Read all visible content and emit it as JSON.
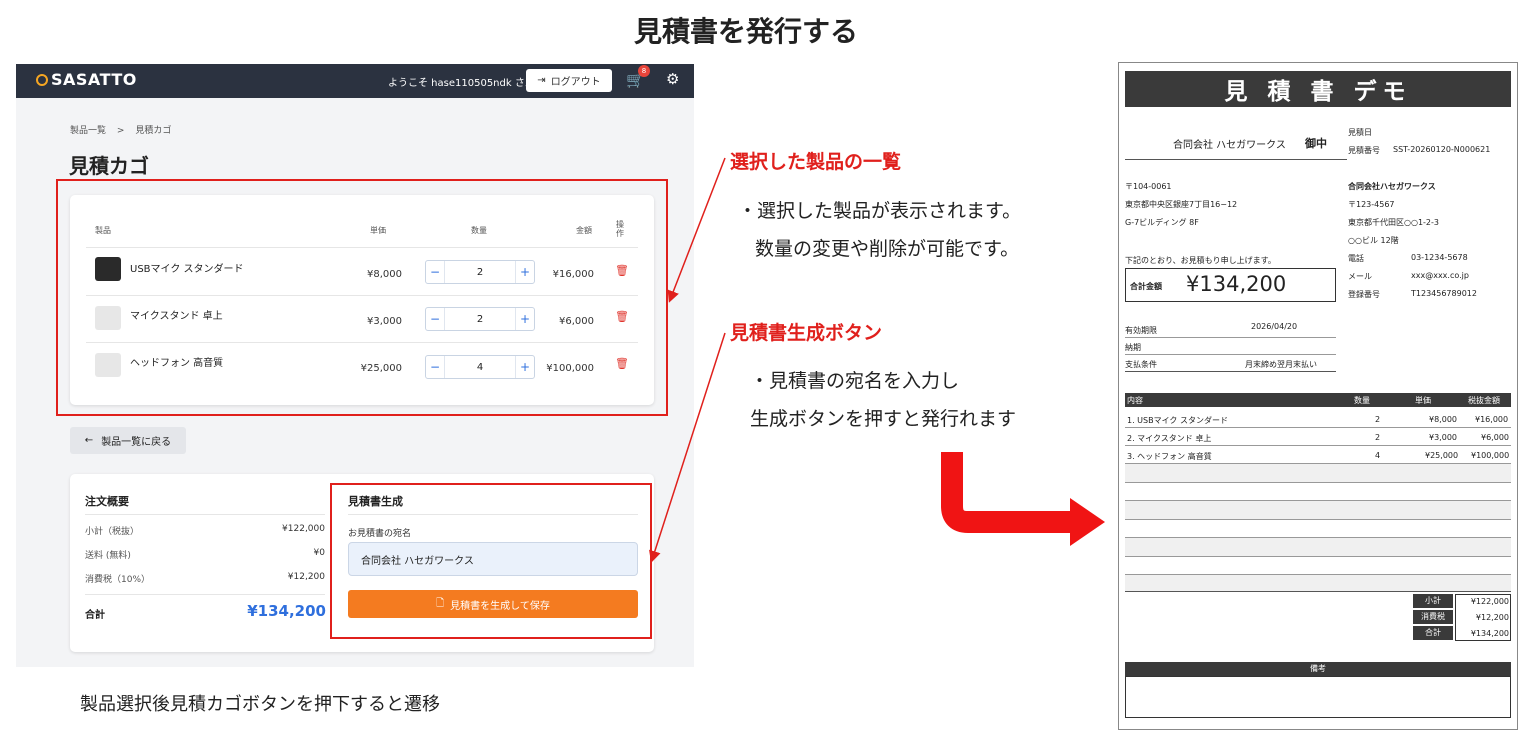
{
  "main_title": "見積書を発行する",
  "appbar": {
    "logo": "SASATTO",
    "welcome": "ようこそ hase110505ndk さん",
    "logout_label": "ログアウト",
    "cart_count": "8"
  },
  "breadcrumb": {
    "root": "製品一覧",
    "sep": ">",
    "current": "見積カゴ"
  },
  "page_title": "見積カゴ",
  "cart_table": {
    "headers": {
      "product": "製品",
      "unit_price": "単価",
      "quantity": "数量",
      "amount": "金額",
      "action": "操作"
    },
    "rows": [
      {
        "name": "USBマイク スタンダード",
        "unit_price": "¥8,000",
        "quantity": "2",
        "amount": "¥16,000"
      },
      {
        "name": "マイクスタンド 卓上",
        "unit_price": "¥3,000",
        "quantity": "2",
        "amount": "¥6,000"
      },
      {
        "name": "ヘッドフォン 高音質",
        "unit_price": "¥25,000",
        "quantity": "4",
        "amount": "¥100,000"
      }
    ]
  },
  "back_button": "製品一覧に戻る",
  "order_summary": {
    "title": "注文概要",
    "subtotal_label": "小計（税抜）",
    "subtotal": "¥122,000",
    "shipping_label": "送料 (無料)",
    "shipping": "¥0",
    "tax_label": "消費税（10%）",
    "tax": "¥12,200",
    "total_label": "合計",
    "total": "¥134,200"
  },
  "quote_gen": {
    "title": "見積書生成",
    "field_label": "お見積書の宛名",
    "field_value": "合同会社 ハセガワークス",
    "button": "見積書を生成して保存"
  },
  "annotations": {
    "a1_title": "選択した製品の一覧",
    "a1_line1": "・選択した製品が表示されます。",
    "a1_line2": "数量の変更や削除が可能です。",
    "a2_title": "見積書生成ボタン",
    "a2_line1": "・見積書の宛名を入力し",
    "a2_line2": "生成ボタンを押すと発行れます"
  },
  "caption": "製品選択後見積カゴボタンを押下すると遷移",
  "doc": {
    "title": "見 積 書  デモ",
    "recipient": "合同会社 ハセガワークス",
    "honorific": "御中",
    "date_label": "見積日",
    "number_label": "見積番号",
    "number": "SST-20260120-N000621",
    "client_zip": "〒104-0061",
    "client_addr1": "東京都中央区銀座7丁目16−12",
    "client_addr2": "G-7ビルディング 8F",
    "intro": "下記のとおり、お見積もり申し上げます。",
    "total_label": "合計金額",
    "total": "¥134,200",
    "issuer_name": "合同会社ハセガワークス",
    "issuer_zip": "〒123-4567",
    "issuer_addr1": "東京都千代田区○○1-2-3",
    "issuer_addr2": "○○ビル 12階",
    "tel_label": "電話",
    "tel": "03-1234-5678",
    "mail_label": "メール",
    "mail": "xxx@xxx.co.jp",
    "reg_label": "登録番号",
    "reg": "T123456789012",
    "valid_label": "有効期限",
    "valid": "2026/04/20",
    "delivery_label": "納期",
    "payment_label": "支払条件",
    "payment": "月末締め翌月末払い",
    "cols": {
      "content": "内容",
      "qty": "数量",
      "unit": "単価",
      "amount": "税抜金額"
    },
    "items": [
      {
        "name": "1.  USBマイク スタンダード",
        "qty": "2",
        "unit": "¥8,000",
        "amount": "¥16,000"
      },
      {
        "name": "2.  マイクスタンド 卓上",
        "qty": "2",
        "unit": "¥3,000",
        "amount": "¥6,000"
      },
      {
        "name": "3.  ヘッドフォン 高音質",
        "qty": "4",
        "unit": "¥25,000",
        "amount": "¥100,000"
      }
    ],
    "subtotal_label": "小計",
    "subtotal": "¥122,000",
    "tax_label": "消費税",
    "tax": "¥12,200",
    "sum_label": "合計",
    "sum": "¥134,200",
    "notes_label": "備考"
  },
  "colors": {
    "accent_red": "#e0201c",
    "orange_button": "#f47b20",
    "total_blue": "#2f6fdd",
    "appbar": "#2b3240"
  }
}
